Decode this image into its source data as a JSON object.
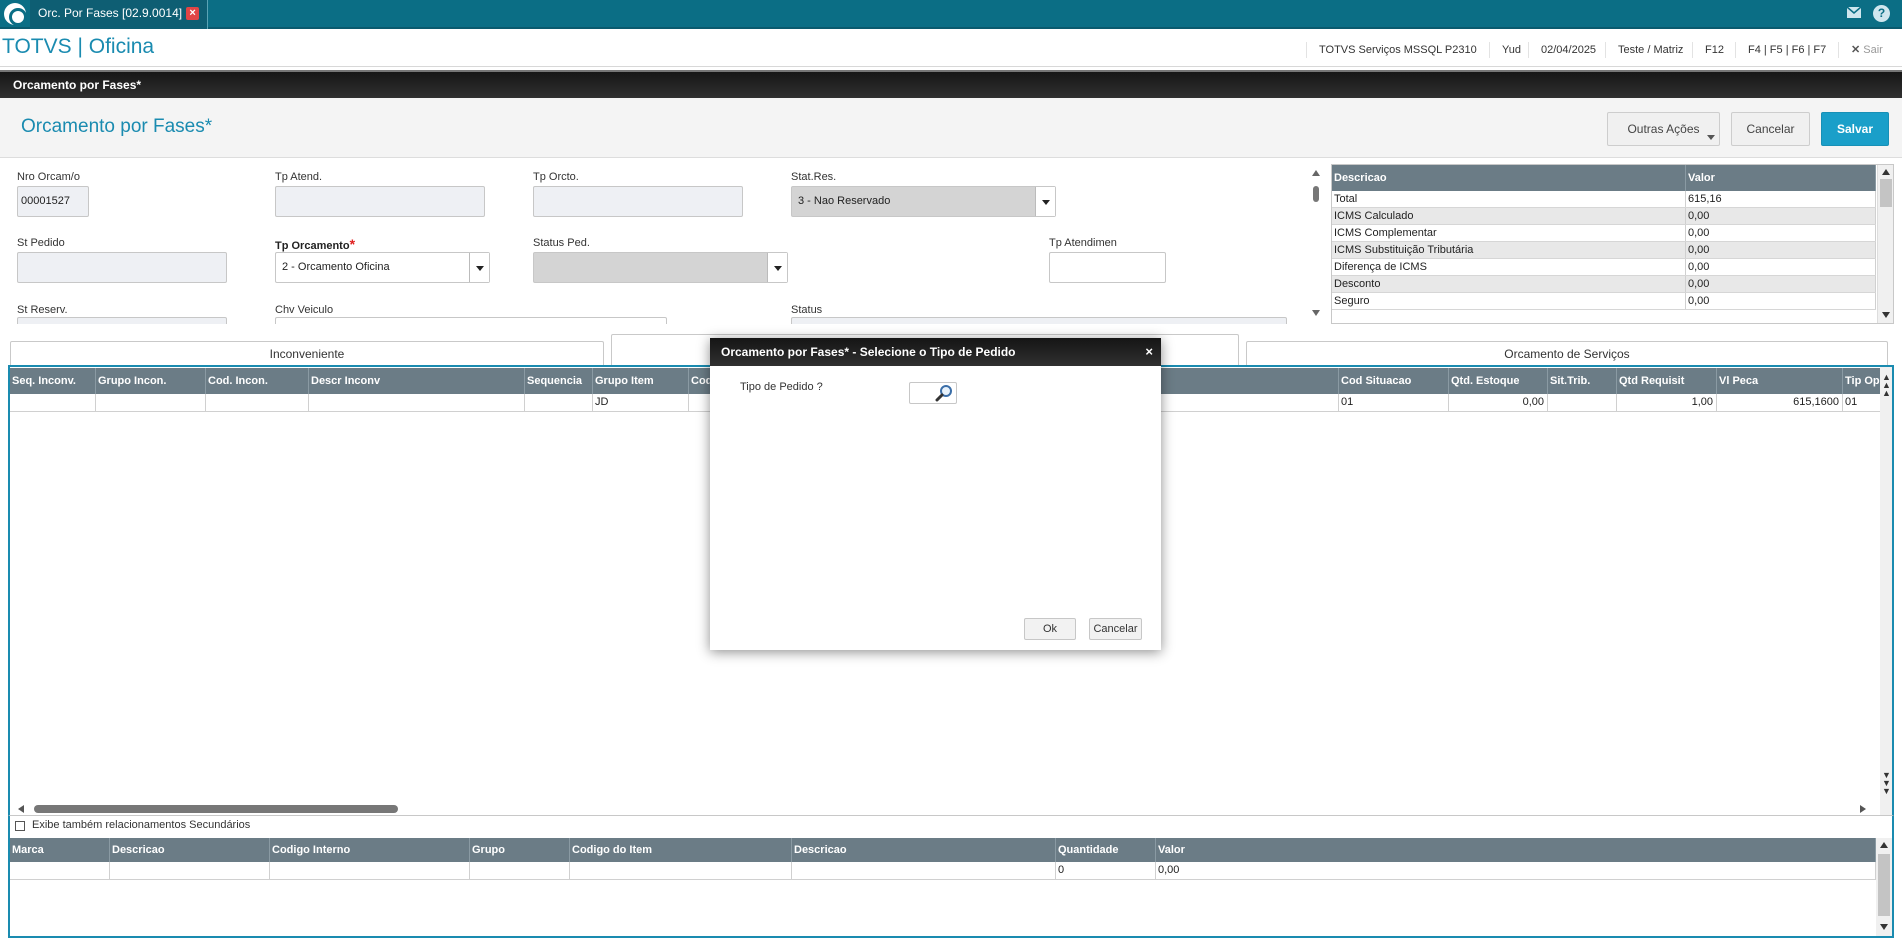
{
  "window": {
    "tab_title": "Orc. Por Fases [02.9.0014]",
    "tab_close": "×"
  },
  "app": {
    "title": "TOTVS | Oficina",
    "status_items": [
      "TOTVS Serviços MSSQL P2310",
      "Yud",
      "02/04/2025",
      "Teste / Matriz",
      "F12",
      "F4 | F5 | F6 | F7"
    ],
    "exit_label": "Sair"
  },
  "darkbar": {
    "title": "Orcamento por Fases*"
  },
  "header": {
    "title": "Orcamento por Fases*",
    "more_actions": "Outras Ações",
    "cancel": "Cancelar",
    "save": "Salvar"
  },
  "form": {
    "nro_orcam_label": "Nro Orcam/o",
    "nro_orcam_value": "00001527",
    "tp_atend_label": "Tp Atend.",
    "tp_orcto_label": "Tp Orcto.",
    "stat_res_label": "Stat.Res.",
    "stat_res_value": "3 - Nao Reservado",
    "st_pedido_label": "St Pedido",
    "tp_orcamento_label": "Tp Orcamento",
    "tp_orcamento_value": "2 - Orcamento Oficina",
    "status_ped_label": "Status Ped.",
    "tp_atendimen_label": "Tp Atendimen",
    "st_reserv_label": "St Reserv.",
    "chv_veiculo_label": "Chv Veiculo",
    "status_label": "Status"
  },
  "totals": {
    "headers": [
      "Descricao",
      "Valor"
    ],
    "rows": [
      [
        "Total",
        "615,16"
      ],
      [
        "ICMS Calculado",
        "0,00"
      ],
      [
        "ICMS Complementar",
        "0,00"
      ],
      [
        "ICMS Substituição Tributária",
        "0,00"
      ],
      [
        "Diferença de ICMS",
        "0,00"
      ],
      [
        "Desconto",
        "0,00"
      ],
      [
        "Seguro",
        "0,00"
      ]
    ]
  },
  "tabs": {
    "inconveniente": "Inconveniente",
    "servicos": "Orcamento de Serviços"
  },
  "grid": {
    "headers": [
      "Seq. Inconv.",
      "Grupo Incon.",
      "Cod. Incon.",
      "Descr Inconv",
      "Sequencia",
      "Grupo Item",
      "Cod",
      "Cod Situacao",
      "Qtd. Estoque",
      "Sit.Trib.",
      "Qtd Requisit",
      "Vl Peca",
      "Tip Operac"
    ],
    "row": [
      "",
      "",
      "",
      "",
      "",
      "JD",
      "",
      "01",
      "0,00",
      "",
      "1,00",
      "615,1600",
      "01"
    ]
  },
  "secondary": {
    "checkbox_label": "Exibe também relacionamentos Secundários",
    "headers": [
      "Marca",
      "Descricao",
      "Codigo Interno",
      "Grupo",
      "Codigo do Item",
      "Descricao",
      "Quantidade",
      "Valor"
    ],
    "row": [
      "",
      "",
      "",
      "",
      "",
      "",
      "0",
      "0,00"
    ]
  },
  "modal": {
    "title": "Orcamento por Fases* - Selecione o Tipo de Pedido",
    "close": "×",
    "field_label": "Tipo de Pedido ?",
    "ok": "Ok",
    "cancel": "Cancelar"
  },
  "colors": {
    "topbar": "#0b6e85",
    "accent": "#1a9fc9",
    "grid_header": "#6b7c86"
  }
}
